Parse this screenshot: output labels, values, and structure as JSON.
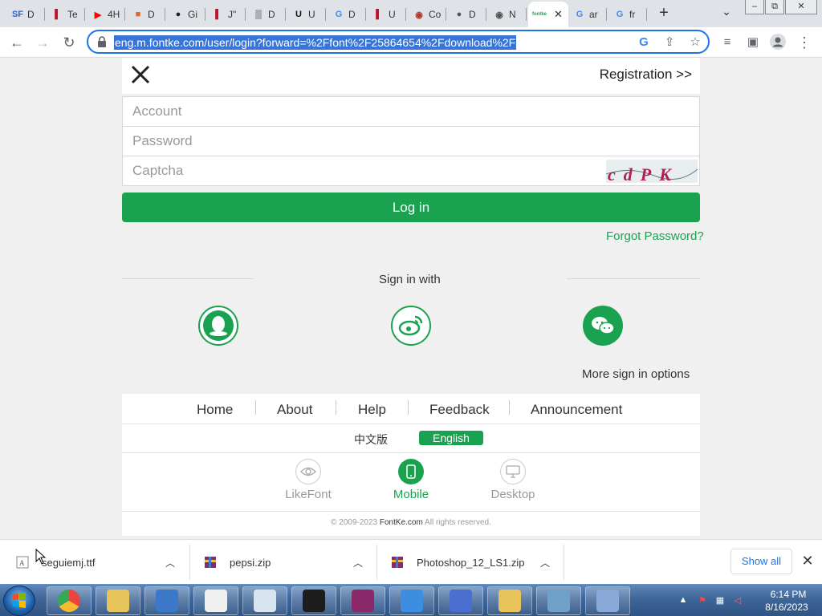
{
  "browser": {
    "tabs": [
      {
        "favicon": "SF",
        "favicon_color": "#2a66c8",
        "label": "D"
      },
      {
        "favicon": "▌",
        "favicon_color": "#c8102e",
        "label": "Te"
      },
      {
        "favicon": "▶",
        "favicon_color": "#ff0000",
        "label": "4H"
      },
      {
        "favicon": "■",
        "favicon_color": "#e8641c",
        "label": "D"
      },
      {
        "favicon": "●",
        "favicon_color": "#222222",
        "label": "Gi"
      },
      {
        "favicon": "▌",
        "favicon_color": "#c8102e",
        "label": "J\""
      },
      {
        "favicon": "▒",
        "favicon_color": "#111111",
        "label": "D"
      },
      {
        "favicon": "U",
        "favicon_color": "#111111",
        "label": "U"
      },
      {
        "favicon": "G",
        "favicon_color": "#4285f4",
        "label": "D"
      },
      {
        "favicon": "▌",
        "favicon_color": "#c8102e",
        "label": "U"
      },
      {
        "favicon": "◉",
        "favicon_color": "#b8322a",
        "label": "Co"
      },
      {
        "favicon": "●",
        "favicon_color": "#555555",
        "label": "D"
      },
      {
        "favicon": "◉",
        "favicon_color": "#555555",
        "label": "N"
      },
      {
        "favicon": "fontke",
        "favicon_color": "#1aa251",
        "label": ""
      },
      {
        "favicon": "G",
        "favicon_color": "#4285f4",
        "label": "ar"
      },
      {
        "favicon": "G",
        "favicon_color": "#4285f4",
        "label": "fr"
      }
    ],
    "active_tab_close": "✕",
    "new_tab": "+",
    "tab_list": "⌄",
    "window_controls": [
      "–",
      "⧉",
      "✕"
    ],
    "nav": {
      "back": "←",
      "forward": "→",
      "reload": "↻"
    },
    "url": "eng.m.fontke.com/user/login?forward=%2Ffont%2F25864654%2Fdownload%2F"
  },
  "page": {
    "registration": "Registration >>",
    "account_placeholder": "Account",
    "password_placeholder": "Password",
    "captcha_placeholder": "Captcha",
    "captcha_text": "cdPK",
    "login_button": "Log in",
    "forgot_password": "Forgot Password?",
    "sign_in_with": "Sign in with",
    "social": [
      "qq-icon",
      "weibo-icon",
      "wechat-icon"
    ],
    "more_options": "More sign in options",
    "nav": [
      "Home",
      "About",
      "Help",
      "Feedback",
      "Announcement"
    ],
    "lang_cn": "中文版",
    "lang_en": "English",
    "devices": [
      {
        "label": "LikeFont",
        "active": false
      },
      {
        "label": "Mobile",
        "active": true
      },
      {
        "label": "Desktop",
        "active": false
      }
    ],
    "copyright_prefix": "© 2009-2023",
    "copyright_brand": "FontKe.com",
    "copyright_suffix": "All rights reserved.",
    "accent_color": "#1aa251"
  },
  "downloads": {
    "items": [
      "seguiemj.ttf",
      "pepsi.zip",
      "Photoshop_12_LS1.zip"
    ],
    "show_all": "Show all",
    "close": "✕"
  },
  "taskbar": {
    "time": "6:14 PM",
    "date": "8/16/2023",
    "apps": [
      "chrome",
      "explorer",
      "remote-desktop",
      "7zip",
      "notepad",
      "cat-app",
      "winrar",
      "qbittorrent",
      "infinity-app",
      "shield-app",
      "lambda-app",
      "font-app"
    ]
  }
}
